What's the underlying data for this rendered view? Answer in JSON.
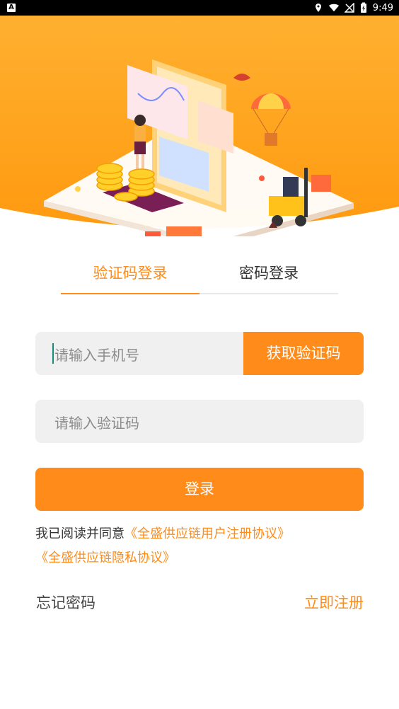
{
  "status_bar": {
    "left_icon": "A",
    "time": "9:49",
    "icons": [
      "location-icon",
      "wifi-icon",
      "no-signal-icon",
      "battery-charging-icon"
    ]
  },
  "colors": {
    "accent": "#ff8c1a",
    "field_bg": "#f0f0f0",
    "header_orange": "#ffa21f"
  },
  "tabs": [
    {
      "label": "验证码登录",
      "active": true
    },
    {
      "label": "密码登录",
      "active": false
    }
  ],
  "phone": {
    "placeholder": "请输入手机号",
    "get_code_label": "获取验证码"
  },
  "code": {
    "placeholder": "请输入验证码"
  },
  "login_label": "登录",
  "agreement": {
    "prefix": "我已阅读并同意",
    "user_agreement": "《全盛供应链用户注册协议》",
    "privacy_policy": "《全盛供应链隐私协议》"
  },
  "footer": {
    "forgot_label": "忘记密码",
    "register_label": "立即注册"
  }
}
